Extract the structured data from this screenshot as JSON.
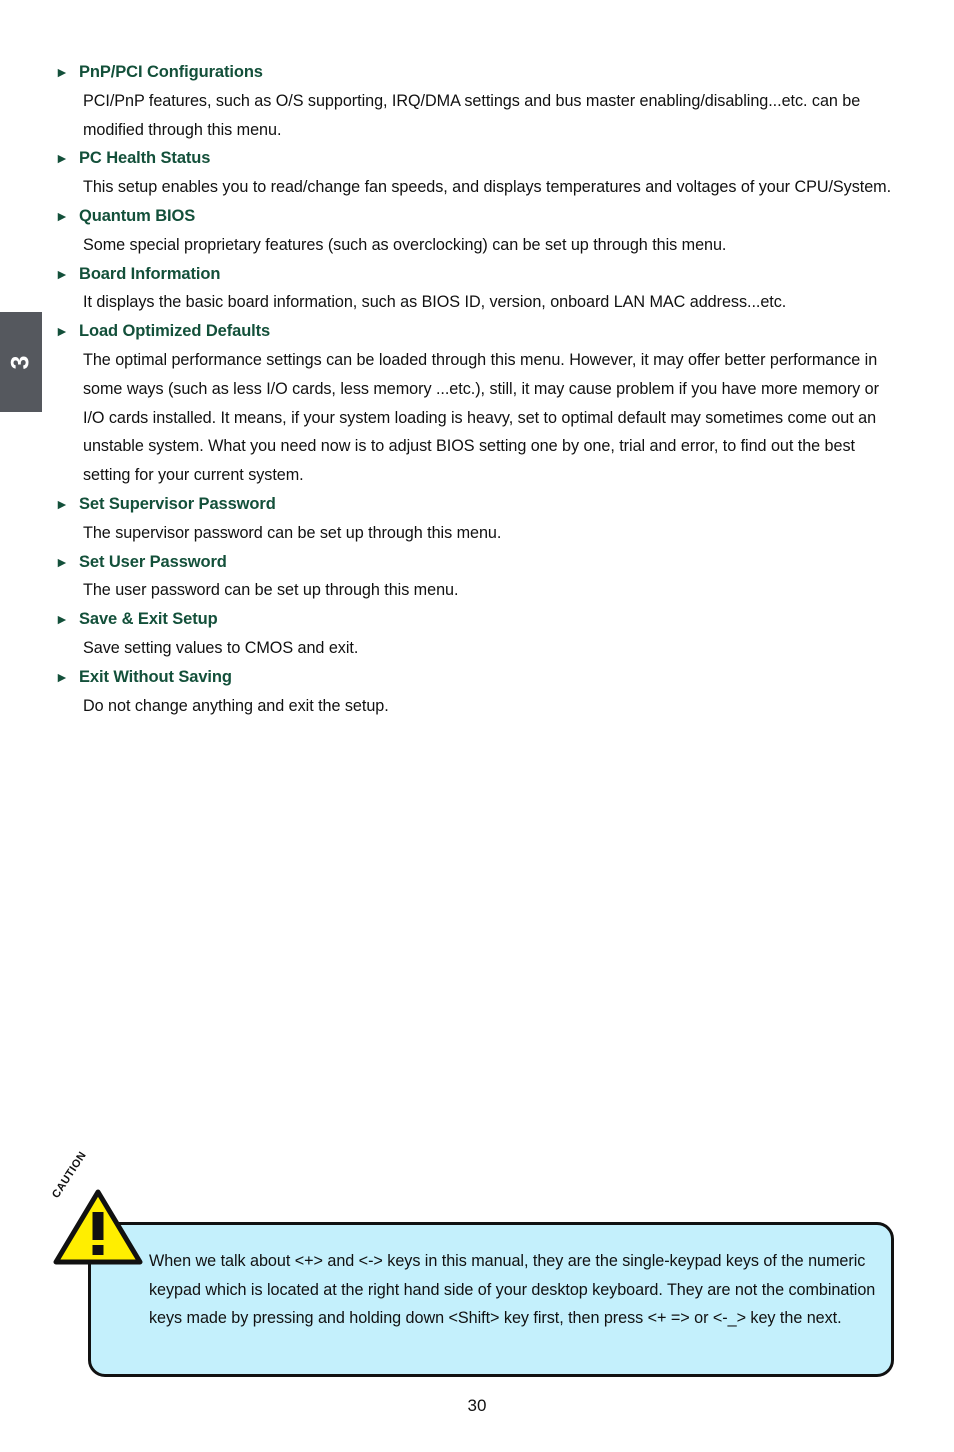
{
  "page": {
    "number": "30",
    "chapter_tab": "3",
    "chapter_tab_color": "#55585e",
    "heading_color": "#13503a",
    "body_color": "#111111"
  },
  "sections": [
    {
      "marker": "►",
      "heading": "PnP/PCI Configurations",
      "body": "PCI/PnP features, such as O/S supporting, IRQ/DMA settings and bus master enabling/disabling...etc. can be modified through this menu."
    },
    {
      "marker": "►",
      "heading": "PC Health Status",
      "body": "This setup enables you to read/change fan speeds, and displays temperatures and voltages of your CPU/System."
    },
    {
      "marker": "►",
      "heading": "Quantum BIOS",
      "body": "Some special proprietary features (such as overclocking) can be set up through this menu."
    },
    {
      "marker": "►",
      "heading": "Board Information",
      "body": "It displays the basic board information, such as BIOS ID, version, onboard LAN MAC address...etc."
    },
    {
      "marker": "►",
      "heading": "Load Optimized Defaults",
      "body": "The optimal performance settings can be loaded through this menu. However, it may offer better performance in some ways (such as less I/O cards, less memory ...etc.), still, it may cause problem if you have more memory or I/O cards installed. It means, if your system loading is heavy, set to optimal default may sometimes come out an unstable system. What you need now is to adjust BIOS setting one by one, trial and error, to find out the best setting for your current system."
    },
    {
      "marker": "►",
      "heading": "Set Supervisor Password",
      "body": "The supervisor password can be set up through this menu."
    },
    {
      "marker": "►",
      "heading": "Set User Password",
      "body": "The user password can be set up through this menu."
    },
    {
      "marker": "►",
      "heading": "Save & Exit Setup",
      "body": "Save setting values to CMOS and exit."
    },
    {
      "marker": "►",
      "heading": "Exit Without Saving",
      "body": "Do not change anything and exit the setup."
    }
  ],
  "caution": {
    "label": "CAUTION",
    "icon": "warning-triangle-icon",
    "icon_fill": "#ffee00",
    "box_background": "#c4f0fc",
    "box_border": "#111111",
    "text": "When we talk about <+> and <-> keys in this manual, they are the single-keypad keys of the numeric keypad which is located at the right hand side of your desktop keyboard. They are not the combination keys made by pressing and holding down <Shift> key first, then press <+ => or <-_> key the next."
  }
}
